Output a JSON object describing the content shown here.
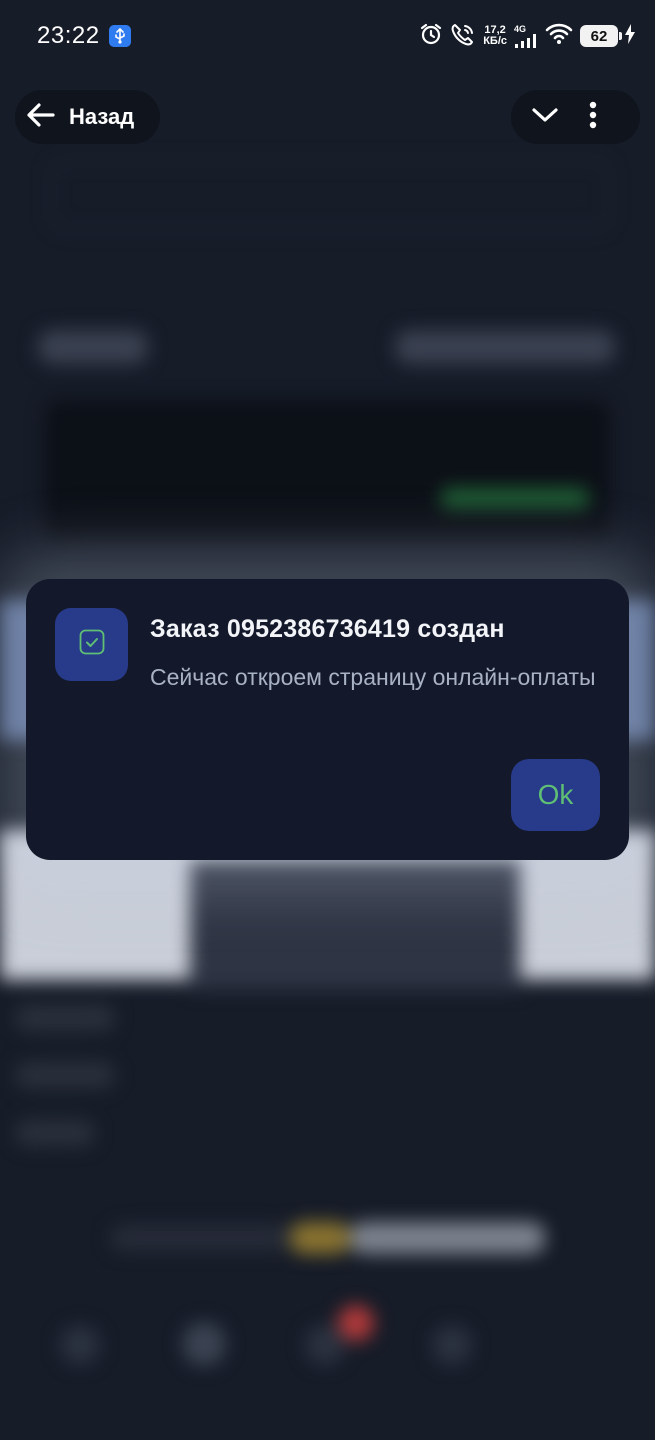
{
  "status_bar": {
    "time": "23:22",
    "net_speed_value": "17,2",
    "net_speed_unit": "КБ/с",
    "network_type": "4G",
    "battery": "62",
    "icons": [
      "usb-icon",
      "alarm-icon",
      "wifi-call-icon",
      "signal-icon",
      "wifi-icon",
      "charging-icon"
    ]
  },
  "header": {
    "back_label": "Назад"
  },
  "dialog": {
    "title": "Заказ 0952386736419 создан",
    "message": "Сейчас откроем страницу онлайн-оплаты",
    "ok_label": "Ok",
    "colors": {
      "background": "#13192b",
      "icon_box": "#283a8a",
      "ok_text": "#5fbf74"
    }
  }
}
